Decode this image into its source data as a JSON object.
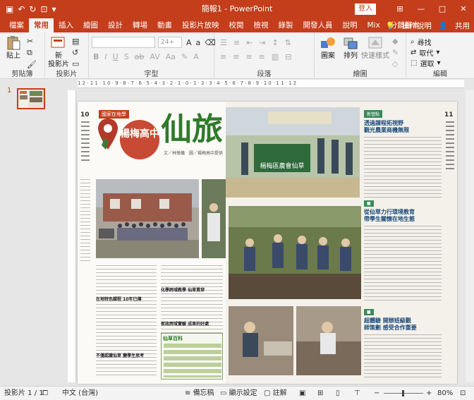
{
  "titlebar": {
    "title": "簡報1  -  PowerPoint",
    "login": "登入"
  },
  "tabs": [
    "檔案",
    "常用",
    "插入",
    "繪圖",
    "設計",
    "轉場",
    "動畫",
    "投影片放映",
    "校閱",
    "檢視",
    "錄製",
    "開發人員",
    "說明",
    "Mix",
    "分鏡腳本"
  ],
  "active_tab": "常用",
  "tabs_right": {
    "tell_me": "操作說明",
    "share": "共用"
  },
  "ribbon": {
    "clipboard": {
      "label": "剪貼簿",
      "paste": "貼上"
    },
    "slides": {
      "label": "投影片",
      "new_slide": "新\n投影片"
    },
    "font": {
      "label": "字型",
      "size_placeholder": "24+"
    },
    "paragraph": {
      "label": "段落"
    },
    "drawing": {
      "label": "繪圖",
      "shapes": "圖案",
      "arrange": "排列",
      "quick_styles": "快速樣式"
    },
    "editing": {
      "label": "編輯",
      "find": "尋找",
      "replace": "取代",
      "select": "選取"
    }
  },
  "thumb": {
    "number": "1"
  },
  "ruler_labels": "12·11·10·9·8·7·6·5·4·3·2·1·0·1·2·3·4·5·6·7·8·9·10·11·12",
  "newspaper": {
    "left_badge": "國家在地學",
    "school": "楊梅高中",
    "headline": "仙旅",
    "byline": "文／林憶儀　圖／楊梅高中提供",
    "page_left": "10",
    "page_right": "11",
    "right_badge": "新營點",
    "right_h1": "透過課程拓視野\n觀光農業商機無限",
    "right_h2": "從仙草力行環境教育\n帶學生關懷在地生態",
    "right_h3": "超體驗 開辦班級觀\n師策劃 感受合作重要",
    "sign_text": "楊梅區農會仙草",
    "section_1": "在地特色課程 10年已傳",
    "section_2": "化學跨域教學 仙草貫穿",
    "section_3": "家政跨域實驗 成果的好處",
    "section_4": "仙草百科",
    "section_5": "不僅認識仙草 變學生思考"
  },
  "status": {
    "slide_pos": "投影片 1 / 1",
    "lang": "中文 (台灣)",
    "notes": "備忘稿",
    "display": "顯示設定",
    "comments": "註解",
    "zoom": "80%"
  }
}
